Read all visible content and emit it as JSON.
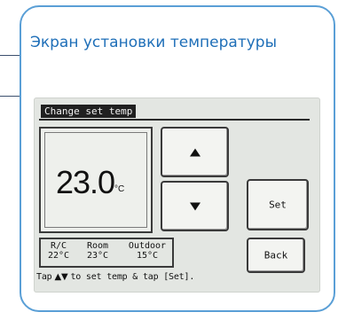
{
  "callout": {
    "title": "Экран установки температуры"
  },
  "screen": {
    "header": "Change set temp",
    "set_temperature": {
      "value": "23.0",
      "unit": "°C"
    },
    "buttons": {
      "up_icon": "triangle-up-icon",
      "down_icon": "triangle-down-icon",
      "set_label": "Set",
      "back_label": "Back"
    },
    "status": {
      "rc": {
        "label": "R/C",
        "value": "22°C"
      },
      "room": {
        "label": "Room",
        "value": "23°C"
      },
      "outdoor": {
        "label": "Outdoor",
        "value": "15°C"
      }
    },
    "hint": {
      "prefix": "Tap",
      "arrows": "▲▼",
      "suffix": "to set temp & tap [Set]."
    }
  },
  "colors": {
    "callout_border": "#5a9fd6",
    "title_text": "#1f6fb8",
    "leader_lines": "#3c4f6e",
    "lcd_background": "#e3e6e2"
  }
}
